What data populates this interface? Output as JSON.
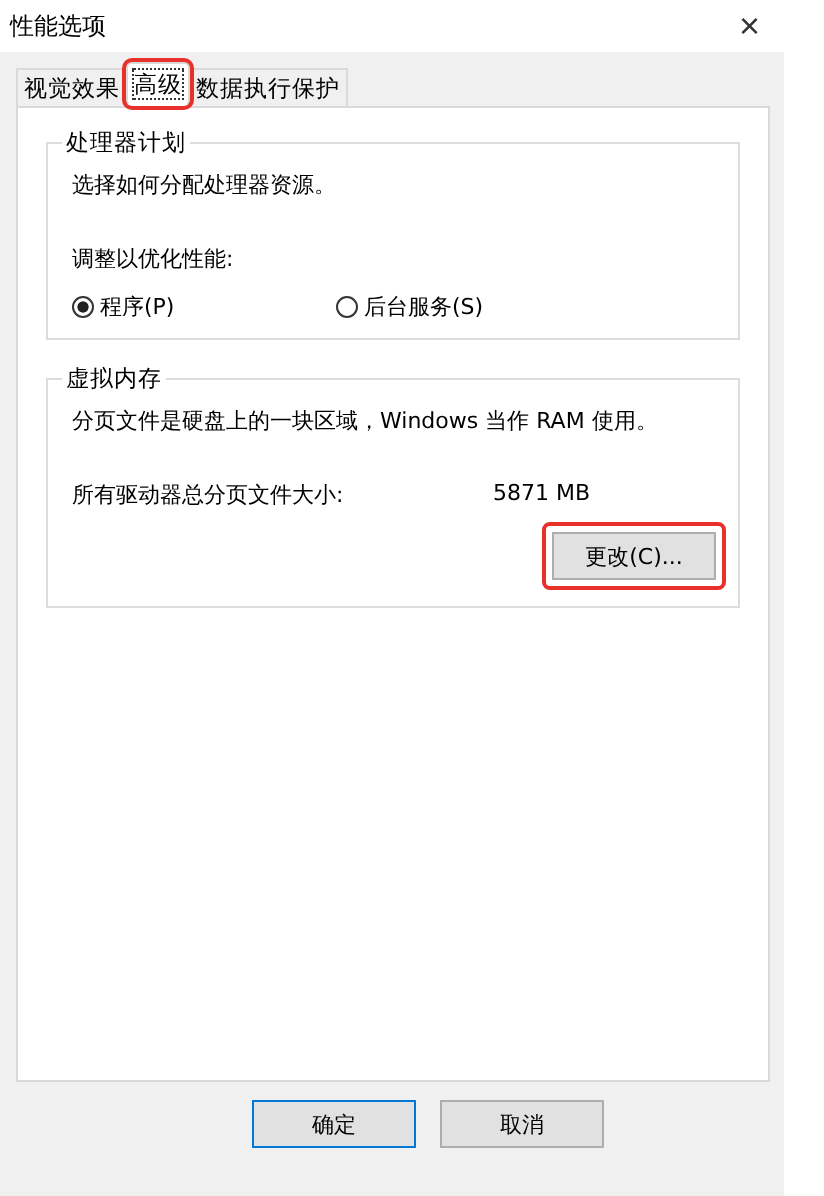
{
  "window": {
    "title": "性能选项",
    "close": "×"
  },
  "tabs": [
    {
      "label": "视觉效果",
      "selected": false,
      "highlighted": false
    },
    {
      "label": "高级",
      "selected": true,
      "highlighted": true
    },
    {
      "label": "数据执行保护",
      "selected": false,
      "highlighted": false
    }
  ],
  "processor_group": {
    "title": "处理器计划",
    "description": "选择如何分配处理器资源。",
    "prompt": "调整以优化性能:",
    "options": [
      {
        "label": "程序(P)",
        "selected": true
      },
      {
        "label": "后台服务(S)",
        "selected": false
      }
    ]
  },
  "memory_group": {
    "title": "虚拟内存",
    "description": "分页文件是硬盘上的一块区域，Windows 当作 RAM 使用。",
    "size_label": "所有驱动器总分页文件大小:",
    "size_value": "5871 MB",
    "change_button": {
      "label": "更改(C)...",
      "highlighted": true
    }
  },
  "buttons": [
    {
      "label": "确定",
      "default": true
    },
    {
      "label": "取消",
      "default": false
    }
  ]
}
